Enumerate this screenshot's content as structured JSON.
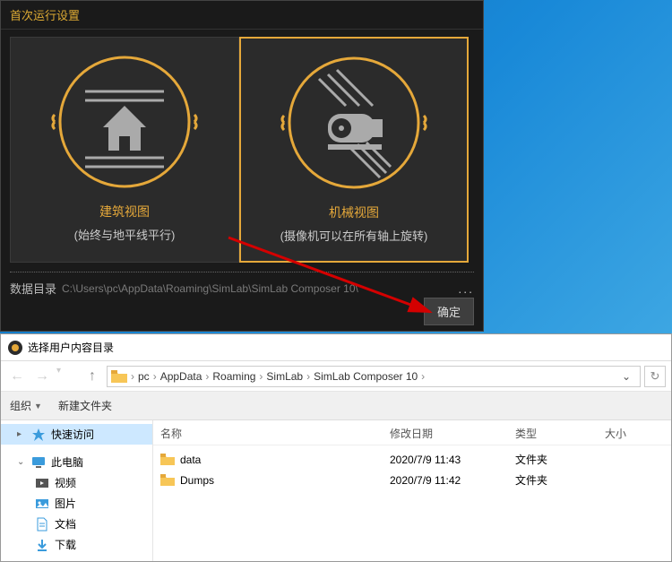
{
  "dialog": {
    "title": "首次运行设置",
    "options": [
      {
        "title": "建筑视图",
        "subtitle": "(始终与地平线平行)"
      },
      {
        "title": "机械视图",
        "subtitle": "(摄像机可以在所有轴上旋转)"
      }
    ],
    "pathLabel": "数据目录",
    "pathValue": "C:\\Users\\pc\\AppData\\Roaming\\SimLab\\SimLab Composer 10\\",
    "confirm": "确定"
  },
  "explorer": {
    "windowTitle": "选择用户内容目录",
    "breadcrumb": [
      "pc",
      "AppData",
      "Roaming",
      "SimLab",
      "SimLab Composer 10"
    ],
    "toolbar": {
      "organize": "组织",
      "newFolder": "新建文件夹"
    },
    "sidebar": {
      "quickAccess": "快速访问",
      "thisPC": "此电脑",
      "video": "视频",
      "pictures": "图片",
      "documents": "文档",
      "downloads": "下载"
    },
    "columns": {
      "name": "名称",
      "date": "修改日期",
      "type": "类型",
      "size": "大小"
    },
    "rows": [
      {
        "name": "data",
        "date": "2020/7/9 11:43",
        "type": "文件夹"
      },
      {
        "name": "Dumps",
        "date": "2020/7/9 11:42",
        "type": "文件夹"
      }
    ]
  }
}
